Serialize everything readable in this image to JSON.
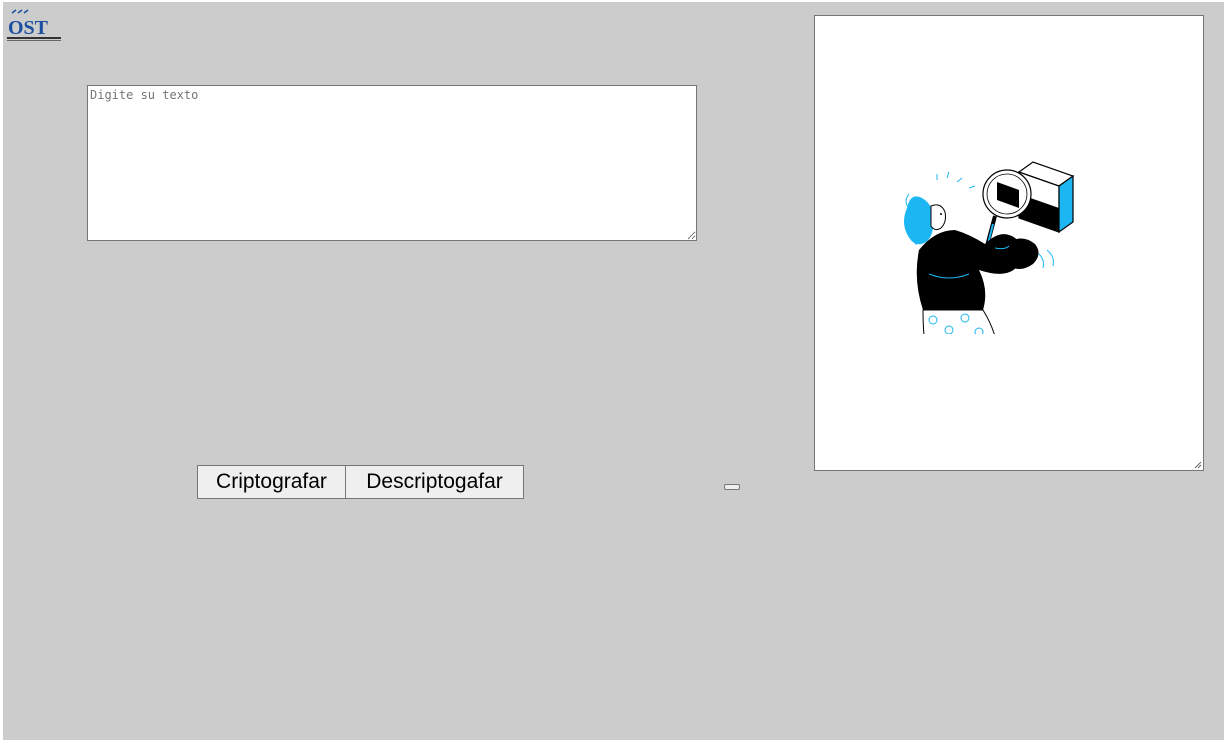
{
  "logo": {
    "text": "OST",
    "icon": "ost-logo-icon"
  },
  "input": {
    "placeholder": "Digite su texto",
    "value": ""
  },
  "buttons": {
    "encrypt_label": "Criptografar",
    "decrypt_label": "Descriptogafar"
  },
  "output": {
    "illustration": "woman-with-magnifying-glass-illustration"
  },
  "colors": {
    "page_background": "#cccccc",
    "accent_blue": "#1cb7f2",
    "logo_blue": "#1a4fa0"
  }
}
